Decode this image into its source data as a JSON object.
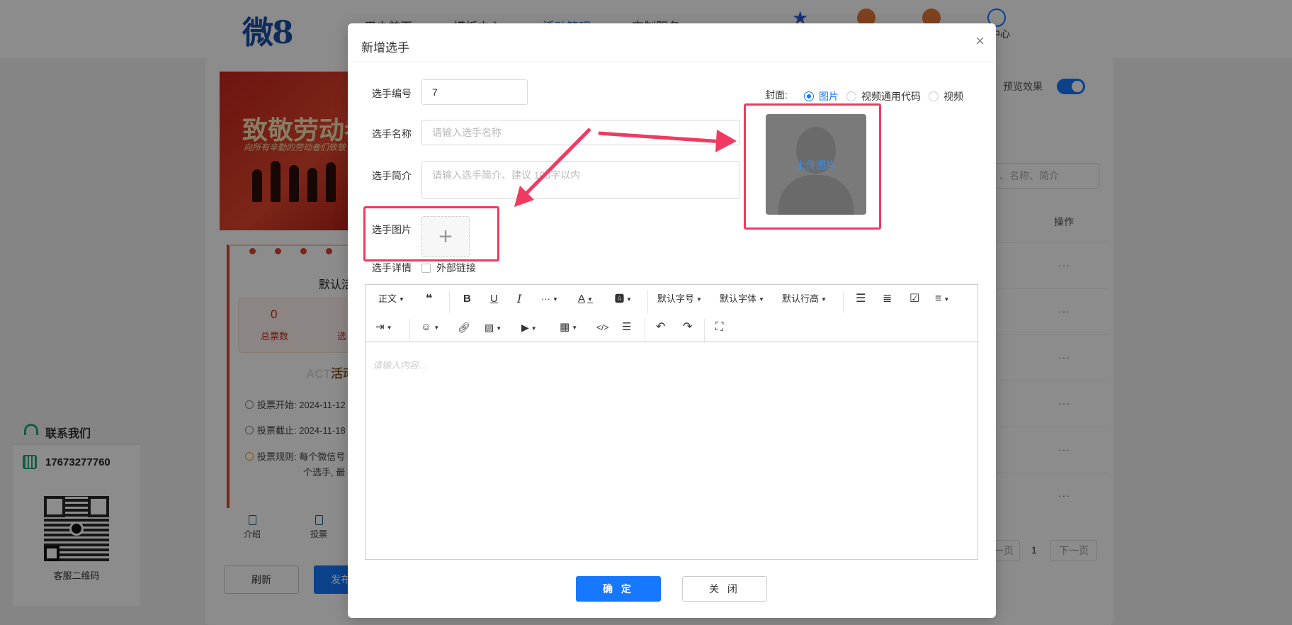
{
  "background": {
    "logo": "微8",
    "nav": [
      "用户首页",
      "模板中心",
      "活动管理",
      "定制服务"
    ],
    "user_center": "中心",
    "banner_title": "致敬劳动者",
    "banner_sub": "向所有辛勤的劳动者们致敬",
    "phone_title": "默认活",
    "stat_value": "0",
    "stat_total_label": "总票数",
    "stat_player_label": "选",
    "act_label": "活动",
    "act_prefix": "ACT",
    "vote_start": "投票开始: 2024-11-12",
    "vote_end": "投票截止: 2024-11-18",
    "vote_rule_1": "投票规则: 每个微信号",
    "vote_rule_2": "个选手, 最",
    "bottom_nav": [
      "介绍",
      "投票"
    ],
    "refresh_label": "刷新",
    "publish_label": "发布",
    "preview_label": "预览效果",
    "search_placeholder": "、名称、简介",
    "op_header": "操作",
    "more": "···",
    "prev_page": "上一页",
    "page_num": "1",
    "next_page": "下一页"
  },
  "contact": {
    "title": "联系我们",
    "phone": "17673277760",
    "qr_label": "客服二维码"
  },
  "modal": {
    "title": "新增选手",
    "close": "×",
    "fields": {
      "number_label": "选手编号",
      "number_value": "7",
      "name_label": "选手名称",
      "name_placeholder": "请输入选手名称",
      "intro_label": "选手简介",
      "intro_placeholder": "请输入选手简介、建议 100字以内",
      "image_label": "选手图片",
      "upload_plus": "+",
      "detail_label": "选手详情",
      "external_link_label": "外部链接"
    },
    "cover": {
      "label": "封面:",
      "options": [
        "图片",
        "视频通用代码",
        "视频"
      ],
      "selected": "图片",
      "upload_label": "上传图片"
    },
    "editor": {
      "toolbar_row1": {
        "paragraph": "正文",
        "font_size": "默认字号",
        "font_family": "默认字体",
        "line_height": "默认行高"
      },
      "placeholder": "请输入内容..."
    },
    "ok_label": "确 定",
    "close_label": "关 闭"
  },
  "colors": {
    "primary": "#1677ff",
    "highlight": "#f03a5f",
    "brand_red": "#d9452f"
  }
}
